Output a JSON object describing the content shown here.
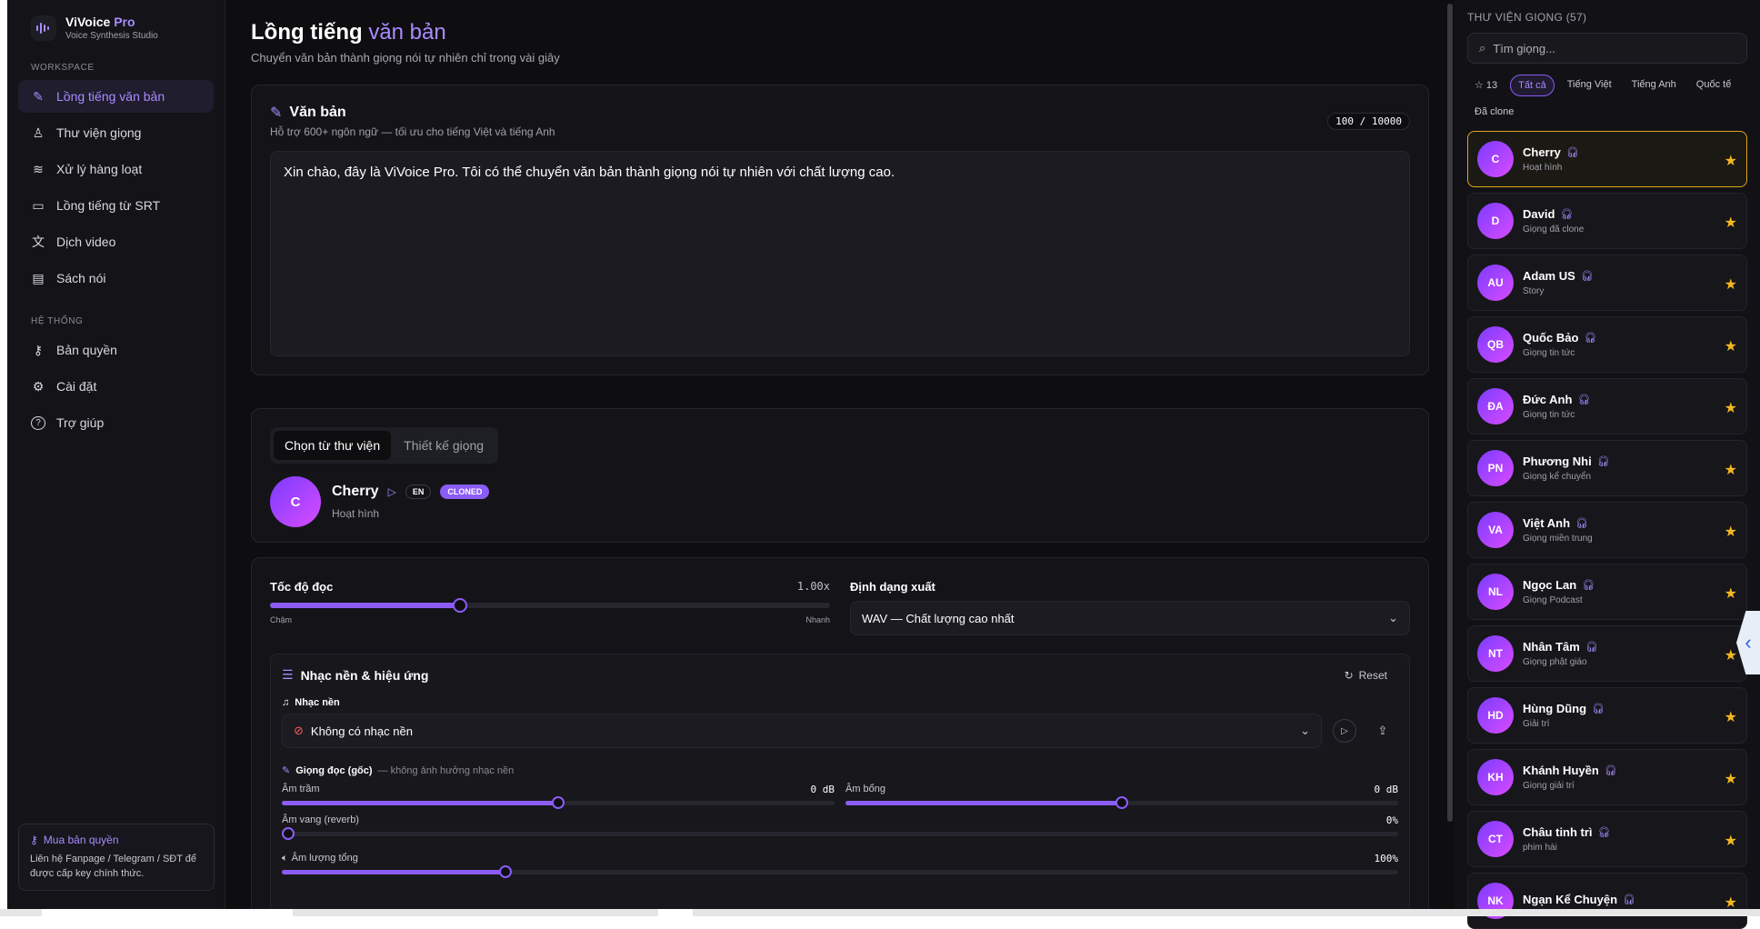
{
  "brand": {
    "name": "ViVoice",
    "name_suffix": "Pro",
    "subtitle": "Voice Synthesis Studio"
  },
  "sidebar": {
    "workspace_label": "WORKSPACE",
    "workspace_items": [
      {
        "label": "Lồng tiếng văn bản",
        "icon": "pen-icon",
        "active": true
      },
      {
        "label": "Thư viện giọng",
        "icon": "user-icon"
      },
      {
        "label": "Xử lý hàng loạt",
        "icon": "layers-icon"
      },
      {
        "label": "Lồng tiếng từ SRT",
        "icon": "subtitle-icon"
      },
      {
        "label": "Dịch video",
        "icon": "translate-icon"
      },
      {
        "label": "Sách nói",
        "icon": "book-icon"
      }
    ],
    "system_label": "HỆ THỐNG",
    "system_items": [
      {
        "label": "Bản quyền",
        "icon": "key-icon"
      },
      {
        "label": "Cài đặt",
        "icon": "gear-icon"
      },
      {
        "label": "Trợ giúp",
        "icon": "help-icon"
      }
    ],
    "license_card": {
      "title": "Mua bản quyền",
      "text": "Liên hệ Fanpage / Telegram / SĐT để được cấp key chính thức."
    }
  },
  "page": {
    "title_main": "Lồng tiếng",
    "title_accent": "văn bản",
    "subtitle": "Chuyển văn bản thành giọng nói tự nhiên chỉ trong vài giây"
  },
  "text_card": {
    "title": "Văn bản",
    "subtitle": "Hỗ trợ 600+ ngôn ngữ — tối ưu cho tiếng Việt và tiếng Anh",
    "counter": "100 / 10000",
    "content": "Xin chào, đây là ViVoice Pro. Tôi có thể chuyển văn bản thành giọng nói tự nhiên với chất lượng cao."
  },
  "voice_card": {
    "tab_library": "Chọn từ thư viện",
    "tab_design": "Thiết kế giọng",
    "selected": {
      "initial": "C",
      "name": "Cherry",
      "lang": "EN",
      "badge": "CLONED",
      "category": "Hoạt hình"
    }
  },
  "settings": {
    "speed_label": "Tốc độ đọc",
    "speed_value": "1.00x",
    "speed_fraction": 0.34,
    "speed_min_label": "Chậm",
    "speed_max_label": "Nhanh",
    "format_label": "Định dạng xuất",
    "format_value": "WAV — Chất lượng cao nhất",
    "fx": {
      "title": "Nhạc nền & hiệu ứng",
      "reset": "Reset",
      "music_label": "Nhạc nền",
      "music_value": "Không có nhạc nền",
      "voice_label": "Giọng đọc (gốc)",
      "voice_note": "— không ảnh hưởng nhạc nền",
      "bass_label": "Âm trầm",
      "bass_value": "0 dB",
      "bass_fraction": 0.5,
      "treble_label": "Âm bổng",
      "treble_value": "0 dB",
      "treble_fraction": 0.5,
      "reverb_label": "Âm vang (reverb)",
      "reverb_value": "0%",
      "reverb_fraction": 0.0,
      "volume_label": "Âm lượng tổng",
      "volume_value": "100%",
      "volume_fraction": 0.2
    }
  },
  "library": {
    "title": "THƯ VIỆN GIỌNG (57)",
    "search_placeholder": "Tìm giọng...",
    "filters": [
      {
        "label": "☆ 13"
      },
      {
        "label": "Tất cả",
        "active": true
      },
      {
        "label": "Tiếng Việt"
      },
      {
        "label": "Tiếng Anh"
      },
      {
        "label": "Quốc tế"
      },
      {
        "label": "Đã clone"
      }
    ],
    "voices": [
      {
        "initials": "C",
        "name": "Cherry",
        "sub": "Hoạt hình",
        "selected": true
      },
      {
        "initials": "D",
        "name": "David",
        "sub": "Giọng đã clone"
      },
      {
        "initials": "AU",
        "name": "Adam US",
        "sub": "Story"
      },
      {
        "initials": "QB",
        "name": "Quốc Bảo",
        "sub": "Giọng tin tức"
      },
      {
        "initials": "ĐA",
        "name": "Đức Anh",
        "sub": "Giọng tin tức"
      },
      {
        "initials": "PN",
        "name": "Phương Nhi",
        "sub": "Giọng kể chuyển"
      },
      {
        "initials": "VA",
        "name": "Việt Anh",
        "sub": "Giọng miền trung"
      },
      {
        "initials": "NL",
        "name": "Ngọc Lan",
        "sub": "Giọng Podcast"
      },
      {
        "initials": "NT",
        "name": "Nhân Tâm",
        "sub": "Giọng phật giáo"
      },
      {
        "initials": "HD",
        "name": "Hùng Dũng",
        "sub": "Giải trí"
      },
      {
        "initials": "KH",
        "name": "Khánh Huyền",
        "sub": "Giọng giải trí"
      },
      {
        "initials": "CT",
        "name": "Châu tinh trì",
        "sub": "phim hài"
      },
      {
        "initials": "NK",
        "name": "Ngạn Kể Chuyện",
        "sub": ""
      }
    ]
  },
  "colors": {
    "accent": "#8b5cf6",
    "accent_text": "#a98bff",
    "star": "#f5b71f",
    "selected_border": "#e0a51c",
    "background": "#0e0e11"
  }
}
